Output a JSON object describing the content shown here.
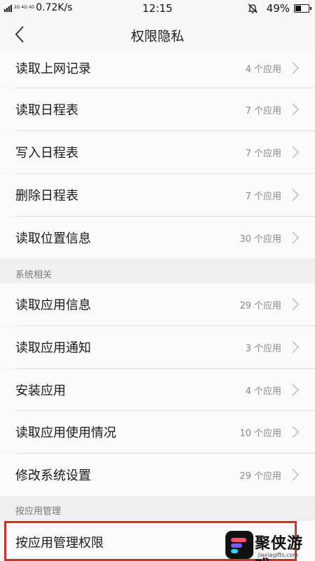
{
  "status_bar": {
    "network_types": "2G 4G 4G",
    "speed": "0.72K/s",
    "time": "12:15",
    "battery_percent": "49%",
    "battery_level": 0.49,
    "icons": [
      "signal-icon",
      "mute-bell-icon",
      "battery-icon"
    ]
  },
  "nav": {
    "title": "权限隐私",
    "back_icon": "chevron-left-icon"
  },
  "sections": [
    {
      "header": "",
      "items": [
        {
          "label": "读取上网记录",
          "count": "4 个应用"
        },
        {
          "label": "读取日程表",
          "count": "7 个应用"
        },
        {
          "label": "写入日程表",
          "count": "7 个应用"
        },
        {
          "label": "删除日程表",
          "count": "7 个应用"
        },
        {
          "label": "读取位置信息",
          "count": "30 个应用"
        }
      ]
    },
    {
      "header": "系统相关",
      "items": [
        {
          "label": "读取应用信息",
          "count": "29 个应用"
        },
        {
          "label": "读取应用通知",
          "count": "3 个应用"
        },
        {
          "label": "安装应用",
          "count": "4 个应用"
        },
        {
          "label": "读取应用使用情况",
          "count": "10 个应用"
        },
        {
          "label": "修改系统设置",
          "count": "29 个应用"
        }
      ]
    },
    {
      "header": "按应用管理",
      "items": [
        {
          "label": "按应用管理权限",
          "count": ""
        }
      ]
    }
  ],
  "watermark": {
    "text": "聚侠游戏",
    "url": "jiaxiagifts.com"
  },
  "colors": {
    "highlight_border": "#c0392b",
    "row_bg": "#fafafa",
    "section_bg": "#efefef"
  }
}
